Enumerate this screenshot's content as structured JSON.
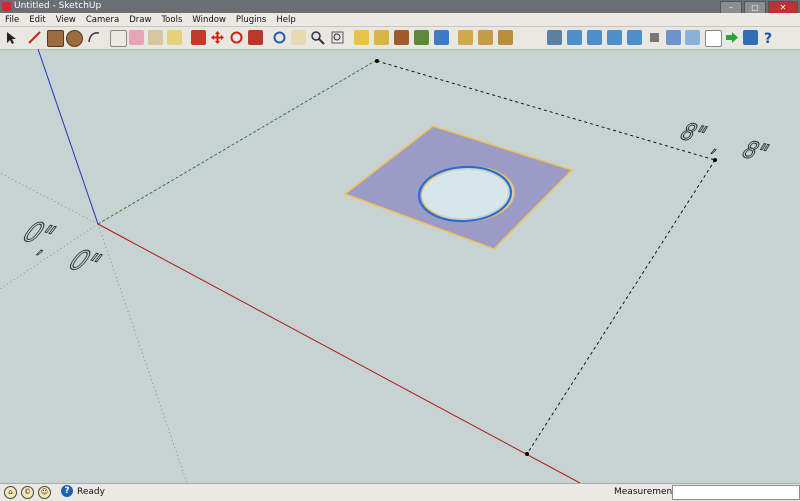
{
  "window": {
    "title": "Untitled - SketchUp"
  },
  "menu": {
    "items": [
      "File",
      "Edit",
      "View",
      "Camera",
      "Draw",
      "Tools",
      "Window",
      "Plugins",
      "Help"
    ]
  },
  "toolbar": {
    "tools": [
      "select-tool",
      "pencil-line-tool",
      "rectangle-tool",
      "circle-tool",
      "arc-tool",
      "make-component-tool",
      "eraser-tool",
      "paint-bucket-tool",
      "push-pull-tool",
      "move-tool",
      "rotate-tool",
      "follow-me-tool",
      "orbit-tool",
      "pan-tool",
      "zoom-tool",
      "zoom-extents-tool",
      "get-models-tool",
      "share-model-tool",
      "share-component-tool",
      "photo-texture-tool",
      "add-location-tool",
      "toggle-terrain-tool",
      "preview-in-google-earth-tool",
      "iso-view",
      "top-view",
      "front-view",
      "right-view",
      "back-view",
      "left-view",
      "section-plane-tool",
      "walk-tool",
      "look-around-tool",
      "position-camera-tool",
      "next-arrow-icon",
      "info-tool",
      "help-icon"
    ]
  },
  "viewport": {
    "dimension_corner": "0\"",
    "dimension_right": "8\""
  },
  "status": {
    "ready": "Ready",
    "measurements_label": "Measurements",
    "measurements_value": ""
  }
}
